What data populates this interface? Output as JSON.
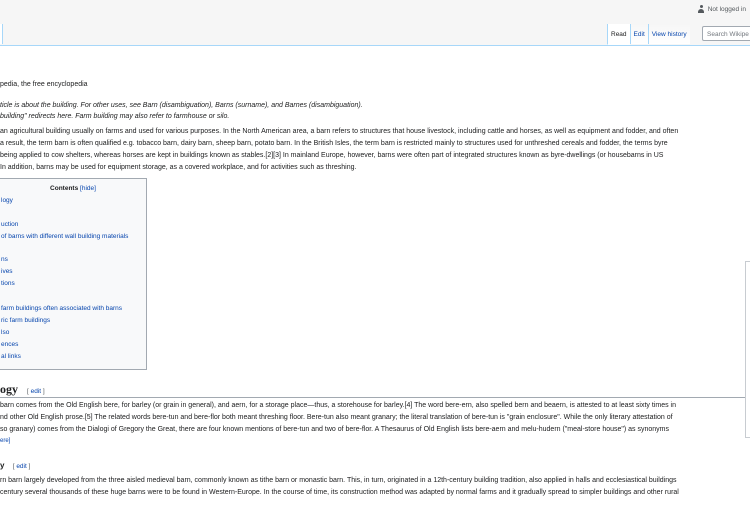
{
  "personal": {
    "label": "Not logged in"
  },
  "tabs": {
    "read": "Read",
    "edit": "Edit",
    "history": "View history"
  },
  "search": {
    "placeholder": "Search Wikipe"
  },
  "tagline": "pedia, the free encyclopedia",
  "hatnotes": [
    "ticle is about the building. For other uses, see Barn (disambiguation), Barns (surname), and Barnes (disambiguation).",
    "building\" redirects here. Farm building may also refer to farmhouse or silo."
  ],
  "intro": [
    "an agricultural building usually on farms and used for various purposes. In the North American area, a barn refers to structures that house livestock, including cattle and horses, as well as equipment and fodder, and often",
    "a result, the term barn is often qualified e.g. tobacco barn, dairy barn, sheep barn, potato barn. In the British Isles, the term barn is restricted mainly to structures used for unthreshed cereals and fodder, the terms byre",
    "being applied to cow shelters, whereas horses are kept in buildings known as stables.[2][3] In mainland Europe, however, barns were often part of integrated structures known as byre-dwellings (or housebarns in US",
    "In addition, barns may be used for equipment storage, as a covered workplace, and for activities such as threshing."
  ],
  "toc": {
    "title": "Contents",
    "hide": "[hide]",
    "items": [
      "logy",
      "",
      "uction",
      "of barns with different wall building materials",
      "",
      "ns",
      "ives",
      "tions",
      "",
      "farm buildings often associated with barns",
      "ric farm buildings",
      "lso",
      "ences",
      "al links"
    ]
  },
  "etymology": {
    "heading": "ogy",
    "edit": "edit",
    "lines": [
      "barn comes from the Old English bere, for barley (or grain in general), and aern, for a storage place—thus, a storehouse for barley.[4] The word bere-ern, also spelled bern and beaern, is attested to at least sixty times in",
      "nd other Old English prose.[5] The related words bere-tun and bere-flor both meant threshing floor. Bere-tun also meant granary; the literal translation of bere-tun is \"grain enclosure\". While the only literary attestation of",
      "so granary) comes from the Dialogi of Gregory the Great, there are four known mentions of bere-tun and two of bere-flor. A Thesaurus of Old English lists bere-aern and melu-hudern (\"meal-store house\") as synonyms",
      "ere]"
    ]
  },
  "history": {
    "heading": "y",
    "edit": "edit",
    "lines": [
      "rn barn largely developed from the three aisled medieval barn, commonly known as tithe barn or monastic barn. This, in turn, originated in a 12th-century building tradition, also applied in halls and ecclesiastical buildings",
      "century several thousands of these huge barns were to be found in Western-Europe. In the course of time, its construction method was adapted by normal farms and it gradually spread to simpler buildings and other rural"
    ]
  }
}
